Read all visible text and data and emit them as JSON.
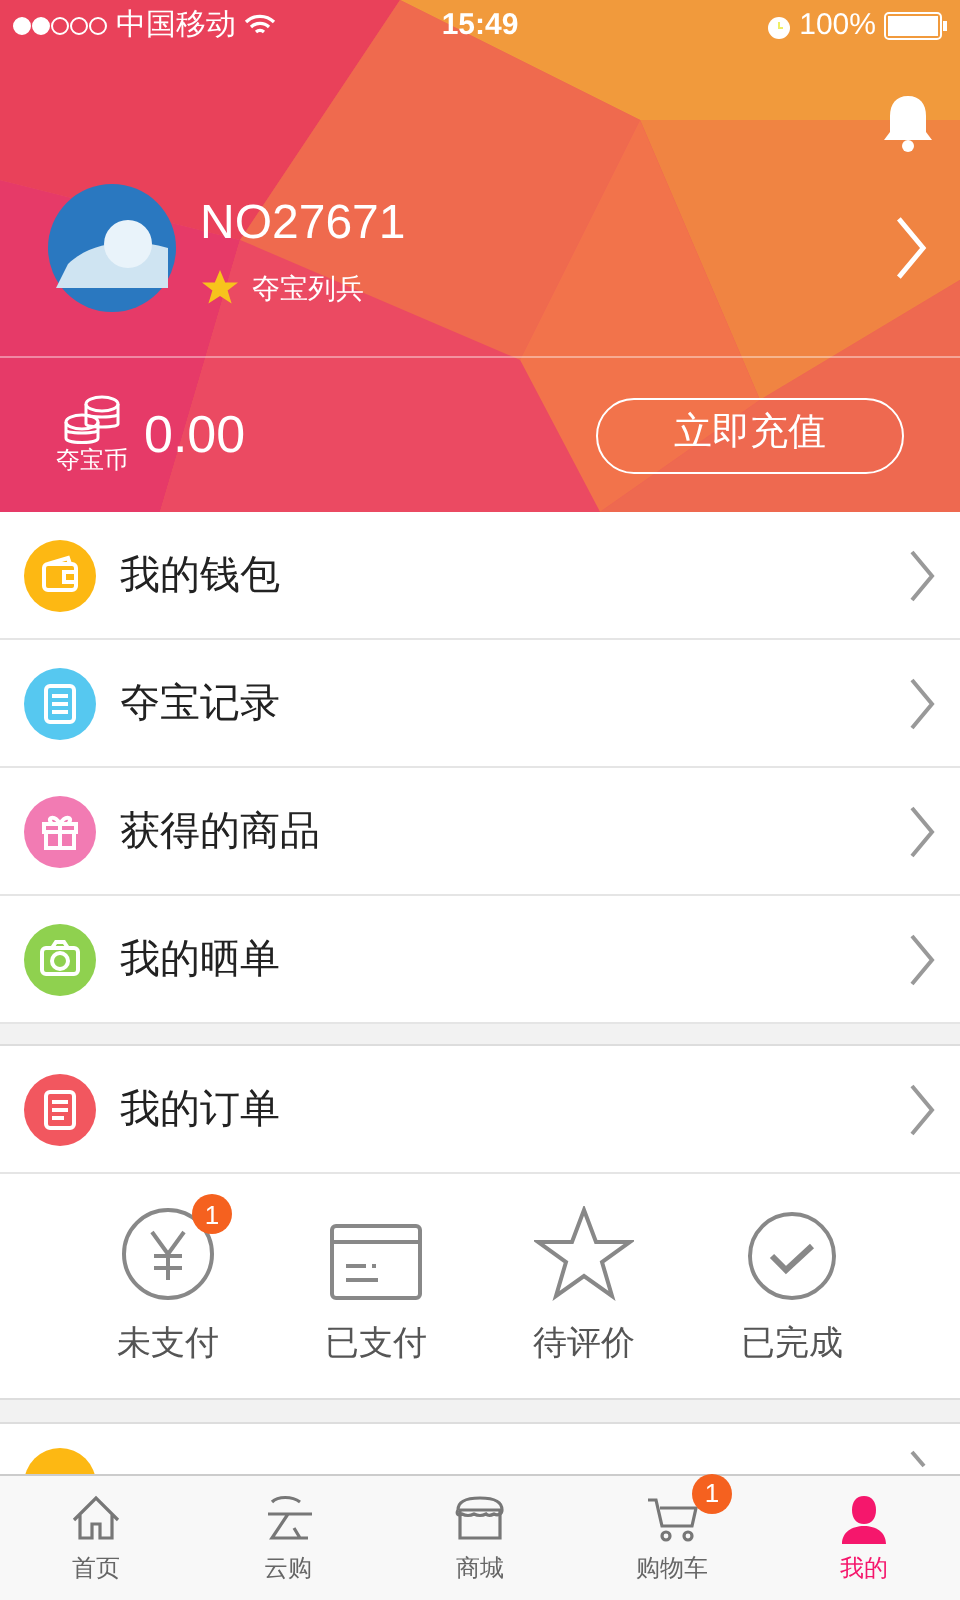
{
  "status_bar": {
    "carrier": "中国移动",
    "time": "15:49",
    "battery": "100%"
  },
  "profile": {
    "name": "NO27671",
    "rank": "夺宝列兵",
    "coin_label": "夺宝币",
    "balance": "0.00",
    "recharge_button": "立即充值"
  },
  "menu": [
    {
      "label": "我的钱包",
      "color": "#fdb813",
      "kind": "wallet"
    },
    {
      "label": "夺宝记录",
      "color": "#56c8f0",
      "kind": "list"
    },
    {
      "label": "获得的商品",
      "color": "#f27bb3",
      "kind": "gift"
    },
    {
      "label": "我的晒单",
      "color": "#8fd14f",
      "kind": "camera"
    }
  ],
  "orders": {
    "label": "我的订单",
    "color": "#f2575f",
    "statuses": [
      {
        "label": "未支付",
        "kind": "yen",
        "badge": "1"
      },
      {
        "label": "已支付",
        "kind": "card"
      },
      {
        "label": "待评价",
        "kind": "star"
      },
      {
        "label": "已完成",
        "kind": "check"
      }
    ]
  },
  "tab_bar": [
    {
      "label": "首页",
      "kind": "home",
      "selected": false
    },
    {
      "label": "云购",
      "kind": "cloud",
      "selected": false
    },
    {
      "label": "商城",
      "kind": "shop",
      "selected": false
    },
    {
      "label": "购物车",
      "kind": "cart",
      "selected": false,
      "badge": "1"
    },
    {
      "label": "我的",
      "kind": "user",
      "selected": true
    }
  ]
}
